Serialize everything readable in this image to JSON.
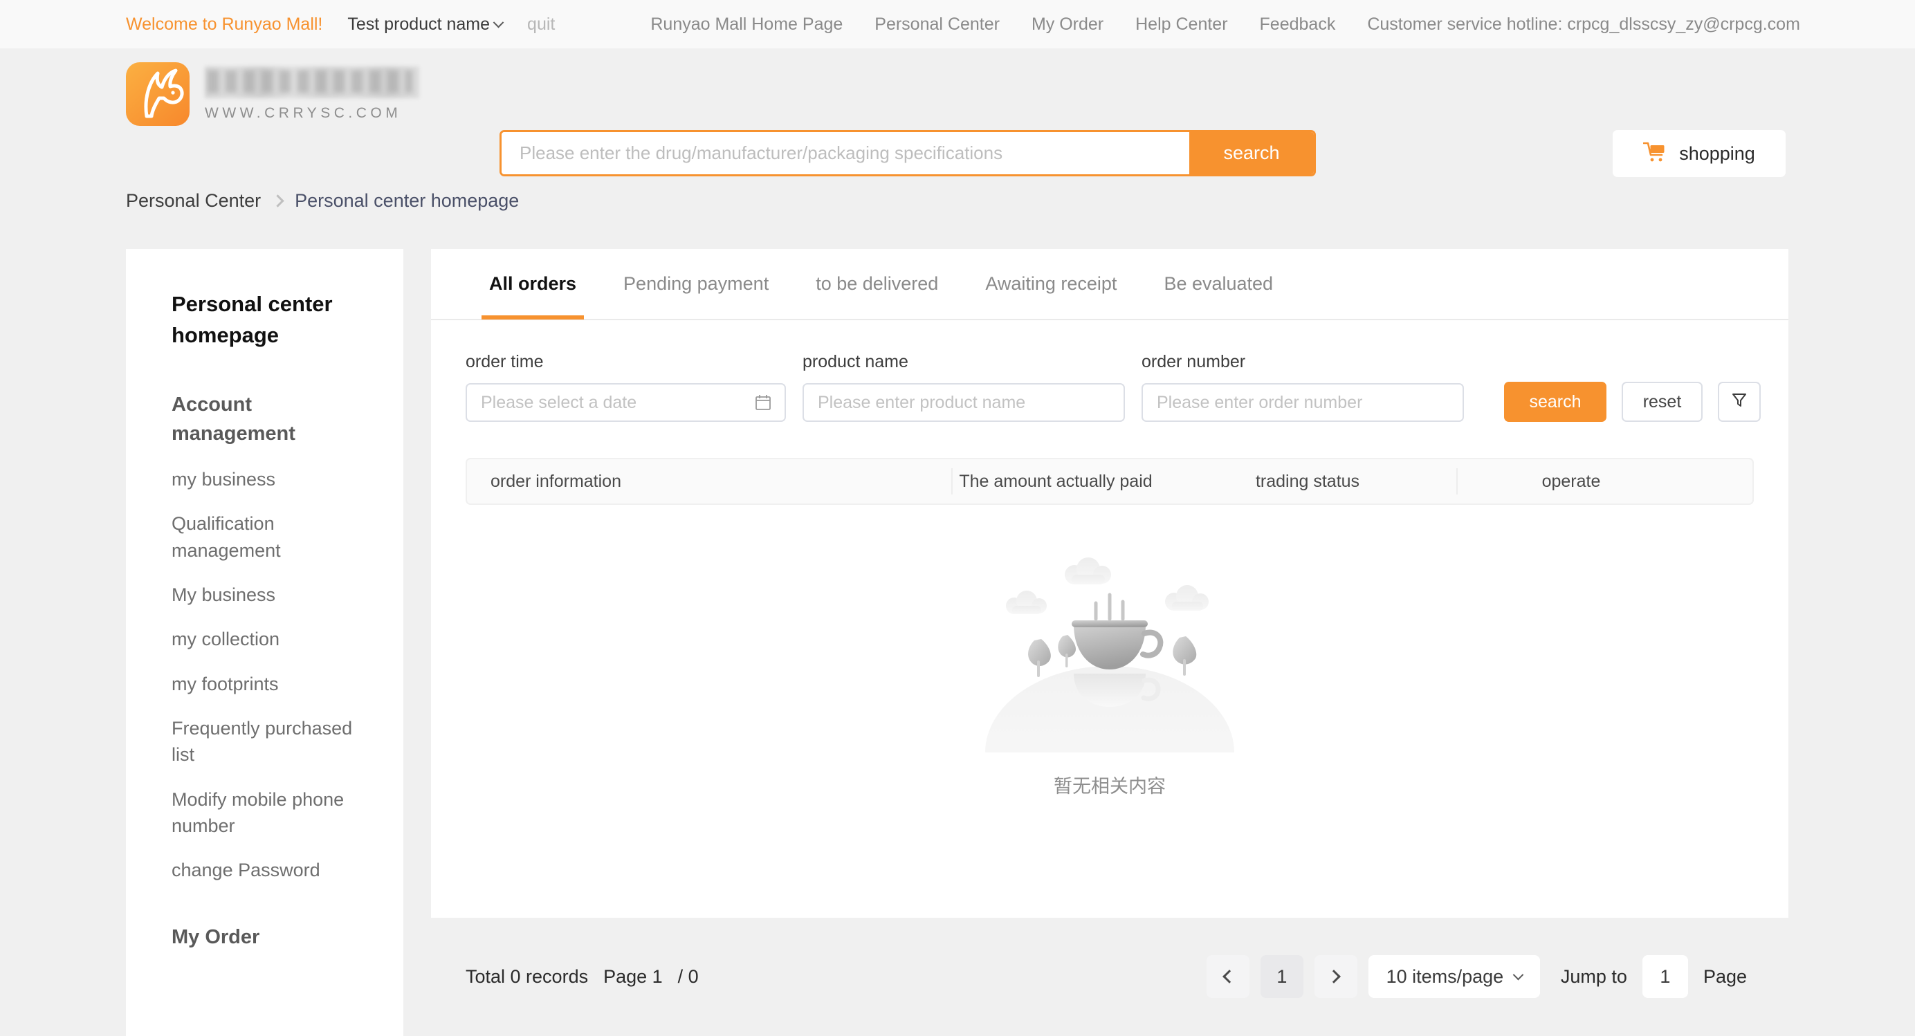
{
  "topbar": {
    "welcome": "Welcome to Runyao Mall!",
    "account_name": "Test product name",
    "quit": "quit",
    "links": [
      "Runyao Mall Home Page",
      "Personal Center",
      "My Order",
      "Help Center",
      "Feedback"
    ],
    "hotline": "Customer service hotline: crpcg_dlsscsy_zy@crpcg.com"
  },
  "header": {
    "logo_url_text": "WWW.CRRYSC.COM",
    "search_placeholder": "Please enter the drug/manufacturer/packaging specifications",
    "search_value": "",
    "search_button": "search",
    "cart_label": "shopping"
  },
  "breadcrumb": {
    "parent": "Personal Center",
    "current": "Personal center homepage"
  },
  "sidebar": {
    "title": "Personal center homepage",
    "groups": [
      {
        "label": "Account management",
        "items": [
          "my business",
          "Qualification management",
          "My business",
          "my collection",
          "my footprints",
          "Frequently purchased list",
          "Modify mobile phone number",
          "change Password"
        ]
      },
      {
        "label": "My Order",
        "items": []
      }
    ]
  },
  "main": {
    "tabs": [
      {
        "label": "All orders",
        "active": true
      },
      {
        "label": "Pending payment",
        "active": false
      },
      {
        "label": "to be delivered",
        "active": false
      },
      {
        "label": "Awaiting receipt",
        "active": false
      },
      {
        "label": "Be evaluated",
        "active": false
      }
    ],
    "filters": {
      "order_time_label": "order time",
      "order_time_placeholder": "Please select a date",
      "order_time_value": "",
      "product_name_label": "product name",
      "product_name_placeholder": "Please enter product name",
      "product_name_value": "",
      "order_number_label": "order number",
      "order_number_placeholder": "Please enter order number",
      "order_number_value": "",
      "search_button": "search",
      "reset_button": "reset"
    },
    "table": {
      "columns": [
        "order information",
        "The amount actually paid",
        "trading status",
        "operate"
      ],
      "rows": [],
      "empty_text": "暂无相关内容"
    }
  },
  "pagination": {
    "total_text": "Total 0 records",
    "page_text": "Page 1",
    "of_text": "/ 0",
    "current_page": "1",
    "page_size_label": "10 items/page",
    "jump_to_label": "Jump to",
    "jump_value": "1",
    "page_word": "Page"
  },
  "colors": {
    "accent": "#f7922f",
    "page_background": "#f0f0f0",
    "panel_background": "#ffffff",
    "breadcrumb_current": "#4a5068"
  }
}
